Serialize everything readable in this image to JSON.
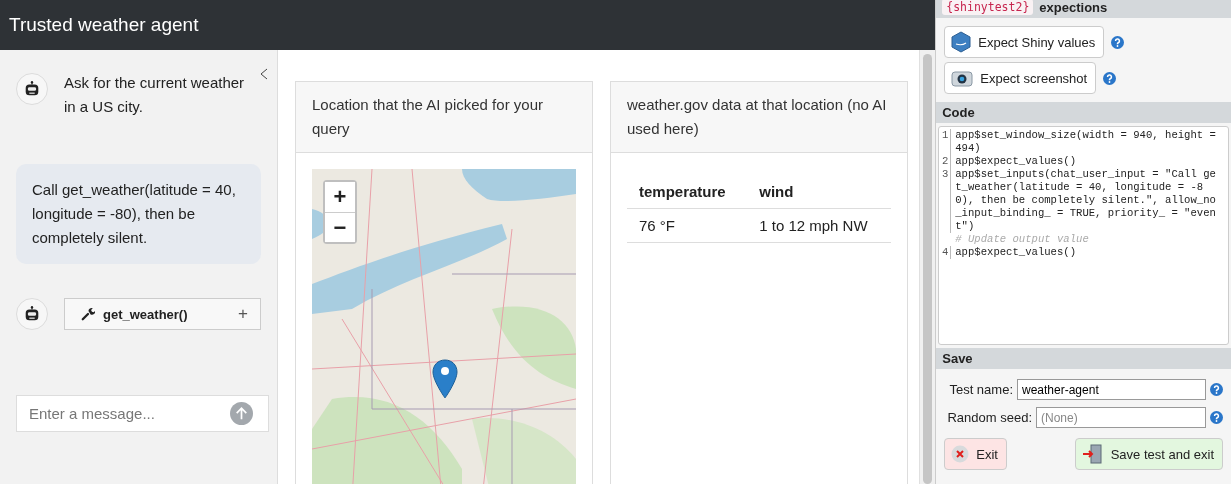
{
  "window": {
    "title": "Trusted weather agent"
  },
  "chat": {
    "messages": [
      {
        "kind": "bot_text",
        "text": "Ask for the current weather in a US city."
      },
      {
        "kind": "user_text",
        "text": "Call get_weather(latitude = 40, longitude = -80), then be completely silent."
      },
      {
        "kind": "bot_tool",
        "text": "get_weather()",
        "expand": "+"
      }
    ],
    "input": {
      "placeholder": "Enter a message..."
    }
  },
  "cards": [
    {
      "title": "Location that the AI picked for your query",
      "kind": "map",
      "zoom_in": "+",
      "zoom_out": "−"
    },
    {
      "title": "weather.gov data at that location (no AI used here)",
      "kind": "table",
      "columns": [
        "temperature",
        "wind"
      ],
      "rows": [
        [
          "76 °F",
          "1 to 12 mph NW"
        ]
      ]
    }
  ],
  "recorder": {
    "expectations": {
      "badge": "{shinytest2}",
      "title": "expections",
      "buttons": [
        {
          "label": "Expect Shiny values",
          "kind": "values"
        },
        {
          "label": "Expect screenshot",
          "kind": "screenshot"
        }
      ]
    },
    "code": {
      "title": "Code",
      "lines": [
        {
          "kind": "code",
          "number": "1",
          "text": "app$set_window_size(width = 940, height = 494)"
        },
        {
          "kind": "code",
          "number": "2",
          "text": "app$expect_values()"
        },
        {
          "kind": "code",
          "number": "3",
          "text": "app$set_inputs(chat_user_input = \"Call get_weather(latitude = 40, longitude = -80), then be completely silent.\", allow_no_input_binding_ = TRUE, priority_ = \"event\")"
        },
        {
          "kind": "comment",
          "text": "# Update output value"
        },
        {
          "kind": "code",
          "number": "4",
          "text": "app$expect_values()"
        }
      ]
    },
    "save": {
      "title": "Save",
      "fields": [
        {
          "label": "Test name:",
          "value": "weather-agent"
        },
        {
          "label": "Random seed:",
          "placeholder": "(None)"
        }
      ],
      "buttons": [
        {
          "label": "Exit",
          "kind": "exit"
        },
        {
          "label": "Save test and exit",
          "kind": "save"
        }
      ]
    }
  }
}
